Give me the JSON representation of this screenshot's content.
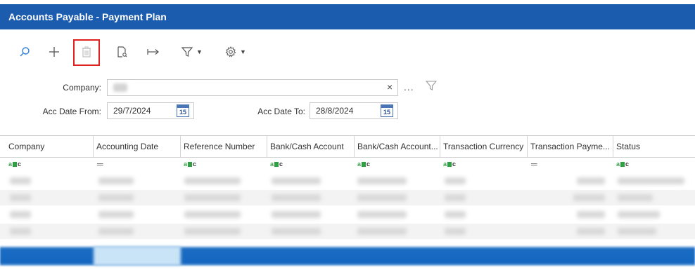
{
  "window": {
    "title": "Accounts Payable - Payment Plan"
  },
  "toolbar": {
    "buttons": [
      {
        "icon": "search-icon"
      },
      {
        "icon": "plus-icon"
      },
      {
        "icon": "delete-icon",
        "disabled": true,
        "highlighted": true
      },
      {
        "icon": "document-search-icon"
      },
      {
        "icon": "arrow-right-icon"
      },
      {
        "icon": "filter-icon",
        "dropdown": true
      },
      {
        "icon": "gear-icon",
        "dropdown": true
      }
    ]
  },
  "form": {
    "company_label": "Company:",
    "acc_date_from_label": "Acc Date From:",
    "acc_date_from_value": "29/7/2024",
    "acc_date_to_label": "Acc Date To:",
    "acc_date_to_value": "28/8/2024",
    "calendar_day": "15",
    "clear_symbol": "×",
    "more_symbol": "..."
  },
  "grid": {
    "columns": [
      {
        "header": "Company",
        "filter": "abc"
      },
      {
        "header": "Accounting Date",
        "filter": "="
      },
      {
        "header": "Reference Number",
        "filter": "abc"
      },
      {
        "header": "Bank/Cash Account",
        "filter": "abc"
      },
      {
        "header": "Bank/Cash Account...",
        "filter": "abc"
      },
      {
        "header": "Transaction Currency",
        "filter": "abc"
      },
      {
        "header": "Transaction Payme...",
        "filter": "="
      },
      {
        "header": "Status",
        "filter": "abc"
      }
    ],
    "row_count": 5,
    "selected_row_index": 4
  },
  "colors": {
    "title_bar": "#1b5cae",
    "selection": "#1566bf",
    "highlight_box": "#e0201f",
    "search_icon": "#2f7fd6"
  }
}
